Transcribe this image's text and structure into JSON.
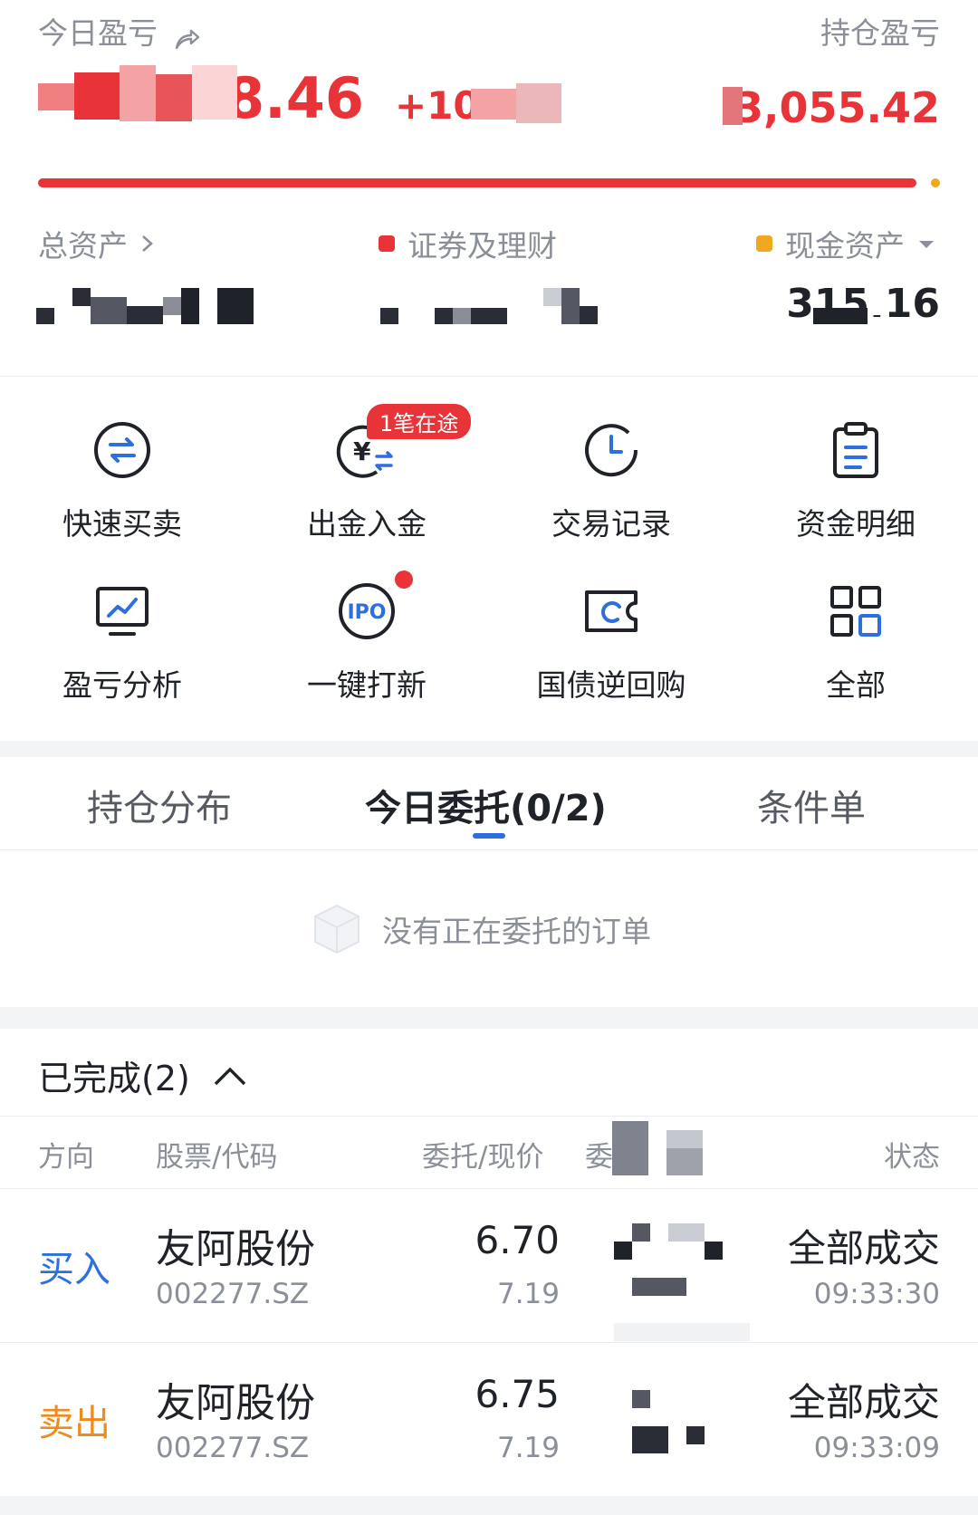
{
  "summary": {
    "today_pl_label": "今日盈亏",
    "today_pl_value": "+78.46",
    "today_pl_pct": "+10.64",
    "holding_pl_label": "持仓盈亏",
    "holding_pl_value": "3,055.42",
    "progress_red_fraction": 0.99
  },
  "assets": {
    "total_label": "总资产",
    "securities_label": "证券及理财",
    "cash_label": "现金资产",
    "cash_value": "315.16"
  },
  "grid": [
    {
      "label": "快速买卖",
      "icon": "swap-icon"
    },
    {
      "label": "出金入金",
      "icon": "yuan-transfer-icon",
      "badge": "1笔在途"
    },
    {
      "label": "交易记录",
      "icon": "clock-icon"
    },
    {
      "label": "资金明细",
      "icon": "clipboard-icon"
    },
    {
      "label": "盈亏分析",
      "icon": "monitor-chart-icon"
    },
    {
      "label": "一键打新",
      "icon": "ipo-icon"
    },
    {
      "label": "国债逆回购",
      "icon": "ticket-icon"
    },
    {
      "label": "全部",
      "icon": "grid-icon"
    }
  ],
  "tabs": [
    "持仓分布",
    "今日委托(0/2)",
    "条件单"
  ],
  "empty_message": "没有正在委托的订单",
  "completed": {
    "title": "已完成(2)",
    "headers": {
      "direction": "方向",
      "stock": "股票/代码",
      "price": "委托/现价",
      "qty": "委托",
      "status": "状态"
    },
    "rows": [
      {
        "direction": "买入",
        "name": "友阿股份",
        "code": "002277.SZ",
        "order_price": "6.70",
        "current_price": "7.19",
        "status": "全部成交",
        "time": "09:33:30"
      },
      {
        "direction": "卖出",
        "name": "友阿股份",
        "code": "002277.SZ",
        "order_price": "6.75",
        "current_price": "7.19",
        "status": "全部成交",
        "time": "09:33:09"
      }
    ]
  },
  "colors": {
    "red": "#e83438",
    "blue": "#2e6fe0",
    "orange": "#f08a1c",
    "gold": "#f0a91e"
  }
}
